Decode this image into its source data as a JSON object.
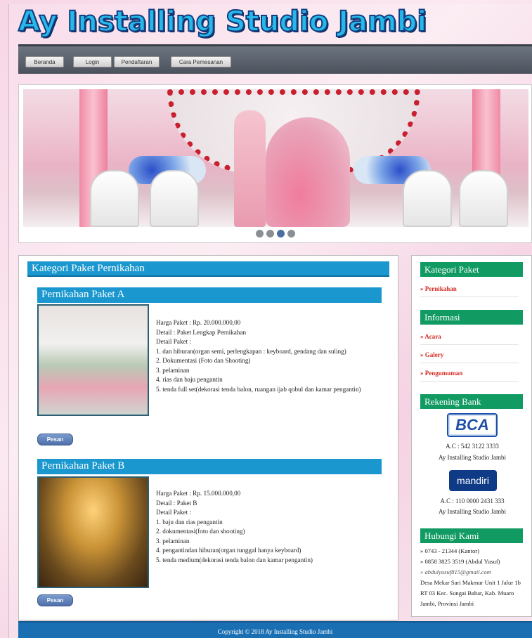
{
  "site": {
    "logo_text": "Ay Installing Studio Jambi"
  },
  "nav": {
    "items": [
      {
        "label": "Beranda"
      },
      {
        "label": "Login"
      },
      {
        "label": "Pendaftaran"
      },
      {
        "label": "Cara Pemesanan"
      }
    ]
  },
  "slider": {
    "dot_count": 4,
    "active_index": 2
  },
  "main": {
    "title": "Kategori Paket Pernikahan",
    "packages": [
      {
        "title": "Pernikahan Paket A",
        "lines": [
          "Harga Paket : Rp. 20.000.000,00",
          "Detail : Paket Lengkap Pernikahan",
          "Detail Paket :",
          "1. dan hiburan(organ semi, perlengkapan : keyboard, gendang dan suling)",
          "2. Dokumentasi (Foto dan Shooting)",
          "3. pelaminan",
          "4. rias dan baju pengantin",
          "5. tenda full set(dekorasi tenda balon, ruangan ijab qobul dan kamar pengantin)"
        ],
        "button": "Pesan"
      },
      {
        "title": "Pernikahan Paket B",
        "lines": [
          "Harga Paket : Rp. 15.000.000,00",
          "Detail : Paket B",
          "Detail Paket :",
          "1. baju dan rias pengantin",
          "2. dokumentasi(foto dan shooting)",
          "3. pelaminan",
          "4. pengantindan hiburan(organ tunggal hanya keyboard)",
          "5. tenda medium(dekorasi tenda balon dan kamar pengantin)"
        ],
        "button": "Pesan"
      }
    ]
  },
  "sidebar": {
    "kategori": {
      "title": "Kategori Paket",
      "links": [
        "» Pernikahan"
      ]
    },
    "informasi": {
      "title": "Informasi",
      "links": [
        "» Acara",
        "» Galery",
        "» Pengumuman"
      ]
    },
    "rekening": {
      "title": "Rekening Bank",
      "banks": [
        {
          "logo": "BCA",
          "account": "A.C : 542 3122 3333",
          "holder": "Ay Installing Studio Jambi"
        },
        {
          "logo": "mandiri",
          "account": "A.C : 110 0000 2431 333",
          "holder": "Ay Installing Studio Jambi"
        }
      ]
    },
    "kontak": {
      "title": "Hubungi Kami",
      "phone_office": "» 0743 - 21344 (Kantor)",
      "phone_mobile": "» 0858 3825 3519 (Abdul Yusuf)",
      "email": "» abdulyusuf815@gmail.com",
      "address": "Desa Mekar Sari Makmur Unit 1 Jalur 1b RT 03 Kec. Sungai Bahar, Kab. Muaro Jambi, Provinsi Jambi"
    }
  },
  "footer": {
    "text": "Copyright © 2018 Ay Installing Studio Jambi"
  },
  "colors": {
    "nav_bg": "#4b525c",
    "heading_blue": "#1a97cf",
    "sidebar_green": "#119b63",
    "link_red": "#d12c24",
    "footer_blue": "#1a6fb3"
  }
}
